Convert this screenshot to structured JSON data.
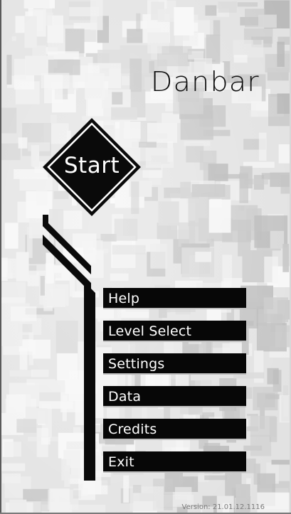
{
  "title": "Danbar",
  "start_label": "Start",
  "menu": [
    "Help",
    "Level Select",
    "Settings",
    "Data",
    "Credits",
    "Exit"
  ],
  "version": "Version: 21.01.12.1116",
  "colors": {
    "button_bg": "#070707",
    "text_light": "#ffffff",
    "title_dark": "#111111",
    "background": "#e4e4e4"
  }
}
